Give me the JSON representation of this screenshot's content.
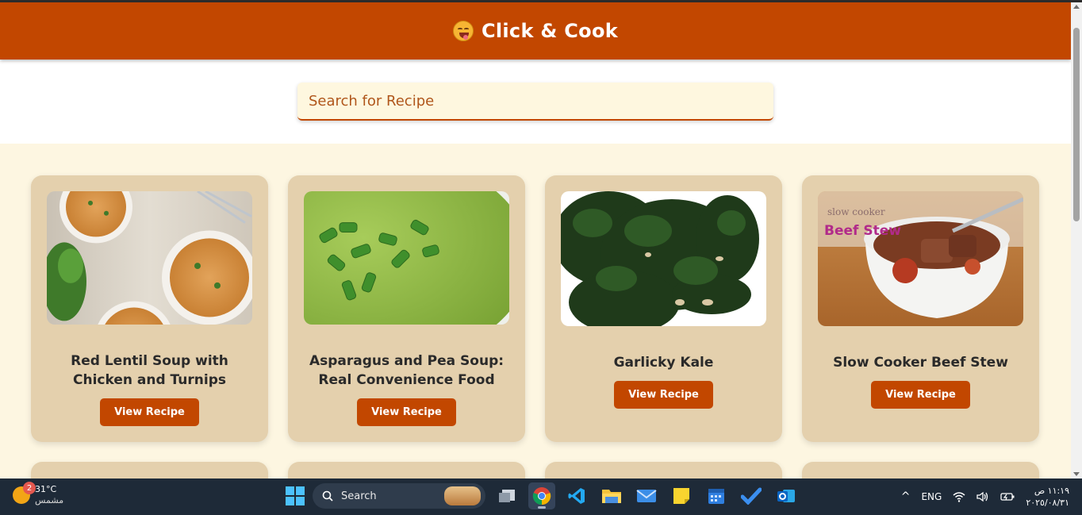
{
  "app": {
    "title": "Click & Cook",
    "logo_icon": "face-savoring-food-emoji",
    "accent_color": "#c24700",
    "card_color": "#e4d0ad",
    "background_color": "#fdf6e1"
  },
  "search": {
    "placeholder": "Search for Recipe",
    "value": ""
  },
  "recipes": [
    {
      "title": "Red Lentil Soup with Chicken and Turnips",
      "button": "View Recipe",
      "image": "lentil-soup-bowls-photo"
    },
    {
      "title": "Asparagus and Pea Soup: Real Convenience Food",
      "button": "View Recipe",
      "image": "green-pea-soup-photo"
    },
    {
      "title": "Garlicky Kale",
      "button": "View Recipe",
      "image": "sauteed-kale-photo"
    },
    {
      "title": "Slow Cooker Beef Stew",
      "button": "View Recipe",
      "image": "beef-stew-bowl-photo"
    }
  ],
  "taskbar": {
    "weather_temp": "31°C",
    "weather_condition": "مشمس",
    "weather_badge": "2",
    "search_label": "Search",
    "language": "ENG",
    "time": "١١:١٩ ص",
    "date": "٢٠٢٥/٠٨/٣١"
  }
}
